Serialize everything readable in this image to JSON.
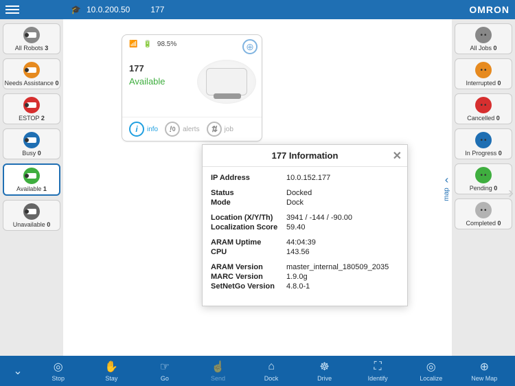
{
  "header": {
    "ip": "10.0.200.50",
    "robot_id": "177",
    "brand": "OMRON"
  },
  "left_filters": [
    {
      "label": "All Robots",
      "count": 3,
      "color": "c-grey",
      "selected": false
    },
    {
      "label": "Needs Assistance",
      "count": 0,
      "color": "c-orange",
      "selected": false
    },
    {
      "label": "ESTOP",
      "count": 2,
      "color": "c-red",
      "selected": false
    },
    {
      "label": "Busy",
      "count": 0,
      "color": "c-blue",
      "selected": false
    },
    {
      "label": "Available",
      "count": 1,
      "color": "c-green",
      "selected": true
    },
    {
      "label": "Unavailable",
      "count": 0,
      "color": "c-dgrey",
      "selected": false
    }
  ],
  "robot_card": {
    "battery": "98.5%",
    "name": "177",
    "status": "Available",
    "tabs": {
      "info": "info",
      "alerts_count": "0",
      "alerts": "alerts",
      "job": "job"
    }
  },
  "info_dialog": {
    "title": "177 Information",
    "fields": {
      "ip_label": "IP Address",
      "ip": "10.0.152.177",
      "status_label": "Status",
      "status": "Docked",
      "mode_label": "Mode",
      "mode": "Dock",
      "loc_label": "Location (X/Y/Th)",
      "loc": "3941 / -144 / -90.00",
      "locscore_label": "Localization Score",
      "locscore": "59.40",
      "uptime_label": "ARAM Uptime",
      "uptime": "44:04:39",
      "cpu_label": "CPU",
      "cpu": "143.56",
      "aramv_label": "ARAM Version",
      "aramv": "master_internal_180509_2035",
      "marcv_label": "MARC Version",
      "marcv": "1.9.0g",
      "sng_label": "SetNetGo Version",
      "sng": "4.8.0-1"
    }
  },
  "right_filters": [
    {
      "label": "All Jobs",
      "count": 0,
      "color": "c-grey"
    },
    {
      "label": "Interrupted",
      "count": 0,
      "color": "c-orange"
    },
    {
      "label": "Cancelled",
      "count": 0,
      "color": "c-red"
    },
    {
      "label": "In Progress",
      "count": 0,
      "color": "c-blue"
    },
    {
      "label": "Pending",
      "count": 0,
      "color": "c-green"
    },
    {
      "label": "Completed",
      "count": 0,
      "color": "c-lgrey"
    }
  ],
  "map_tab": "map",
  "bottom_bar": [
    {
      "label": "Stop",
      "icon": "◎",
      "disabled": false
    },
    {
      "label": "Stay",
      "icon": "✋",
      "disabled": false
    },
    {
      "label": "Go",
      "icon": "☞",
      "disabled": false
    },
    {
      "label": "Send",
      "icon": "☝",
      "disabled": true
    },
    {
      "label": "Dock",
      "icon": "⌂",
      "disabled": false
    },
    {
      "label": "Drive",
      "icon": "☸",
      "disabled": false
    },
    {
      "label": "Identify",
      "icon": "⛶",
      "disabled": false
    },
    {
      "label": "Localize",
      "icon": "◎",
      "disabled": false
    },
    {
      "label": "New Map",
      "icon": "⊕",
      "disabled": false
    }
  ]
}
